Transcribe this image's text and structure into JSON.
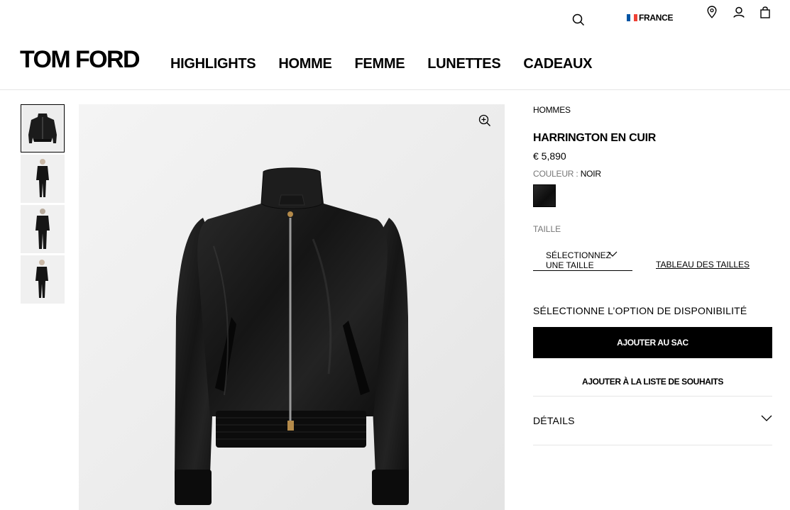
{
  "header": {
    "country": "FRANCE",
    "logo": "TOM FORD",
    "nav": [
      "HIGHLIGHTS",
      "HOMME",
      "FEMME",
      "LUNETTES",
      "CADEAUX"
    ],
    "icons": [
      "search-icon",
      "location-pin-icon",
      "account-icon",
      "shopping-bag-icon"
    ],
    "flag_colors": [
      "#0055A4",
      "#FFFFFF",
      "#EF4135"
    ]
  },
  "gallery": {
    "thumbnail_count": 4,
    "active_thumbnail": 1,
    "zoom_icon": "zoom-in-icon"
  },
  "product": {
    "breadcrumb": "HOMMES",
    "title": "HARRINGTON EN CUIR",
    "price": "€ 5,890",
    "color_label": "COULEUR :",
    "color_value": "NOIR",
    "swatch_color": "#111111",
    "size_label": "TAILLE",
    "size_select_text": "SÉLECTIONNEZ UNE TAILLE",
    "size_chart_link": "TABLEAU DES TAILLES",
    "availability_label": "SÉLECTIONNE L’OPTION DE DISPONIBILITÉ",
    "add_to_bag": "AJOUTER AU SAC",
    "add_to_wishlist": "AJOUTER À LA LISTE DE SOUHAITS",
    "details_label": "DÉTAILS"
  }
}
